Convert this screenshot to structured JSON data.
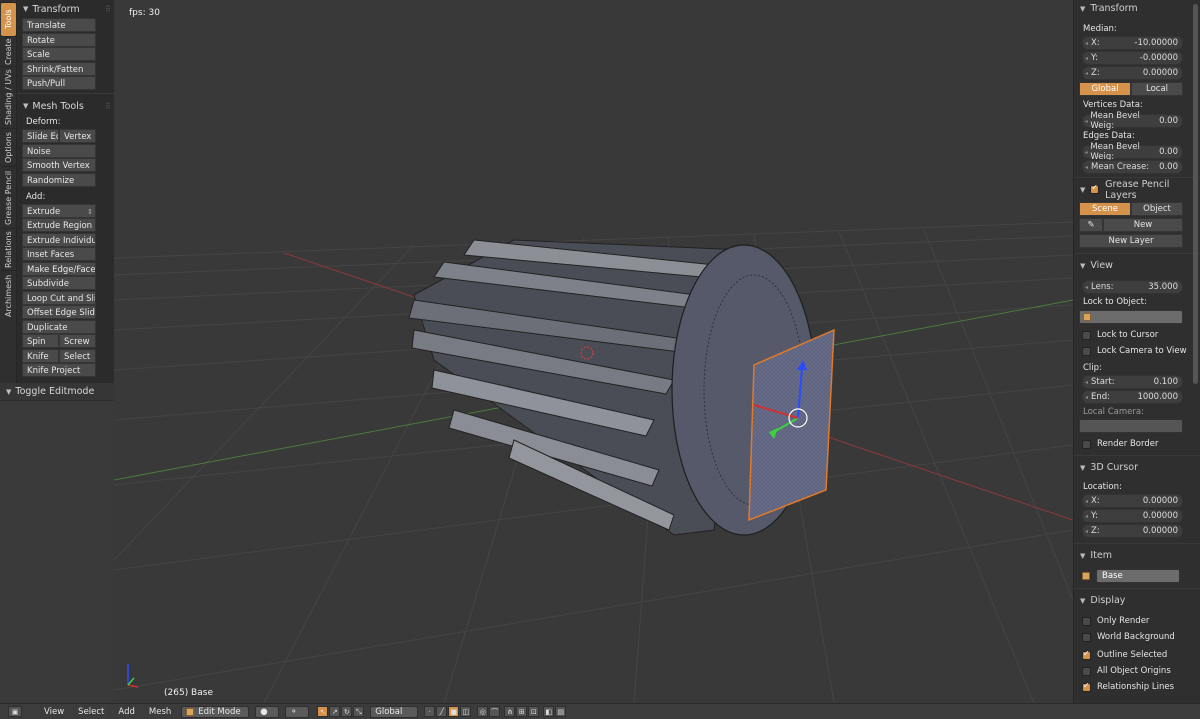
{
  "tabs": [
    "Tools",
    "Create",
    "Shading / UVs",
    "Options",
    "Grease Pencil",
    "Relations",
    "Archimesh"
  ],
  "toolshelf": {
    "transform": {
      "title": "Transform",
      "items": [
        "Translate",
        "Rotate",
        "Scale",
        "Shrink/Fatten",
        "Push/Pull"
      ]
    },
    "mesh_tools": {
      "title": "Mesh Tools",
      "deform_label": "Deform:",
      "slide_edge": "Slide Ed",
      "vertex": "Vertex",
      "deform_items": [
        "Noise",
        "Smooth Vertex",
        "Randomize"
      ],
      "add_label": "Add:",
      "extrude": "Extrude",
      "add_items": [
        "Extrude Region",
        "Extrude Individual",
        "Inset Faces",
        "Make Edge/Face",
        "Subdivide",
        "Loop Cut and Slide",
        "Offset Edge Slide",
        "Duplicate"
      ],
      "spin": "Spin",
      "screw": "Screw",
      "knife": "Knife",
      "select": "Select",
      "knife_project": "Knife Project"
    },
    "redo_panel": "Toggle Editmode"
  },
  "viewport": {
    "fps": "fps: 30",
    "object_label": "(265) Base"
  },
  "properties": {
    "transform": {
      "title": "Transform",
      "median": "Median:",
      "x_label": "X:",
      "x": "-10.00000",
      "y_label": "Y:",
      "y": "-0.00000",
      "z_label": "Z:",
      "z": "0.00000",
      "global": "Global",
      "local": "Local",
      "vertices_data": "Vertices Data:",
      "v_bevel_label": "Mean Bevel Weig:",
      "v_bevel": "0.00",
      "edges_data": "Edges Data:",
      "e_bevel_label": "Mean Bevel Weig:",
      "e_bevel": "0.00",
      "crease_label": "Mean Crease:",
      "crease": "0.00"
    },
    "grease": {
      "title": "Grease Pencil Layers",
      "scene": "Scene",
      "object": "Object",
      "new": "New",
      "new_layer": "New Layer"
    },
    "view": {
      "title": "View",
      "lens_label": "Lens:",
      "lens": "35.000",
      "lock_to_object": "Lock to Object:",
      "lock_cursor": "Lock to Cursor",
      "lock_camera": "Lock Camera to View",
      "clip": "Clip:",
      "start_label": "Start:",
      "start": "0.100",
      "end_label": "End:",
      "end": "1000.000",
      "local_camera": "Local Camera:",
      "render_border": "Render Border"
    },
    "cursor": {
      "title": "3D Cursor",
      "location": "Location:",
      "x_label": "X:",
      "x": "0.00000",
      "y_label": "Y:",
      "y": "0.00000",
      "z_label": "Z:",
      "z": "0.00000"
    },
    "item": {
      "title": "Item",
      "name": "Base"
    },
    "display": {
      "title": "Display",
      "only_render": "Only Render",
      "world_bg": "World Background",
      "outline_selected": "Outline Selected",
      "all_origins": "All Object Origins",
      "relationship_lines": "Relationship Lines"
    }
  },
  "header": {
    "view": "View",
    "select": "Select",
    "add": "Add",
    "mesh": "Mesh",
    "mode": "Edit Mode",
    "orientation": "Global"
  },
  "colors": {
    "accent": "#d4924a",
    "viewport_bg": "#393939",
    "panel_bg": "#2f2f2f"
  }
}
